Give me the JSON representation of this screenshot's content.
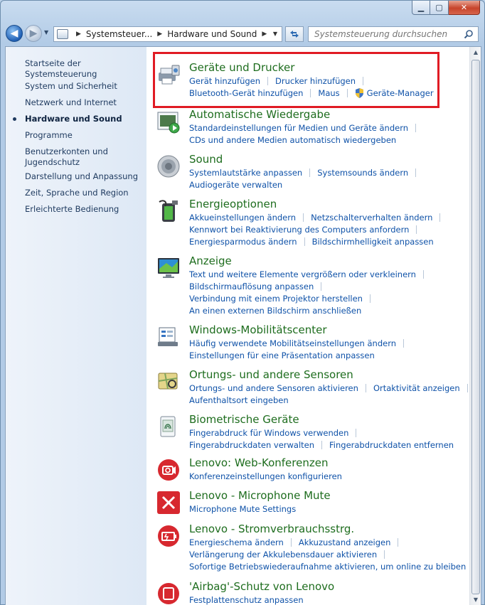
{
  "window": {
    "minimize_label": "▁",
    "maximize_label": "▢",
    "close_label": "✕"
  },
  "nav": {
    "back_label": "◀",
    "forward_label": "▶",
    "breadcrumbs": [
      "Systemsteuer...",
      "Hardware und Sound"
    ],
    "search_placeholder": "Systemsteuerung durchsuchen"
  },
  "sidebar": {
    "items": [
      {
        "label": "Startseite der Systemsteuerung"
      },
      {
        "label": "System und Sicherheit"
      },
      {
        "label": "Netzwerk und Internet"
      },
      {
        "label": "Hardware und Sound"
      },
      {
        "label": "Programme"
      },
      {
        "label": "Benutzerkonten und Jugendschutz"
      },
      {
        "label": "Darstellung und Anpassung"
      },
      {
        "label": "Zeit, Sprache und Region"
      },
      {
        "label": "Erleichterte Bedienung"
      }
    ]
  },
  "sections": [
    {
      "title": "Geräte und Drucker",
      "icon": "printer-icon",
      "lines": [
        [
          "Gerät hinzufügen",
          "Drucker hinzufügen"
        ],
        [
          "Bluetooth-Gerät hinzufügen",
          "Maus",
          "Geräte-Manager"
        ]
      ]
    },
    {
      "title": "Automatische Wiedergabe",
      "icon": "autoplay-icon",
      "lines": [
        [
          "Standardeinstellungen für Medien und Geräte ändern"
        ],
        [
          "CDs und andere Medien automatisch wiedergeben"
        ]
      ]
    },
    {
      "title": "Sound",
      "icon": "speaker-icon",
      "lines": [
        [
          "Systemlautstärke anpassen",
          "Systemsounds ändern"
        ],
        [
          "Audiogeräte verwalten"
        ]
      ]
    },
    {
      "title": "Energieoptionen",
      "icon": "battery-icon",
      "lines": [
        [
          "Akkueinstellungen ändern",
          "Netzschalterverhalten ändern"
        ],
        [
          "Kennwort bei Reaktivierung des Computers anfordern"
        ],
        [
          "Energiesparmodus ändern",
          "Bildschirmhelligkeit anpassen"
        ]
      ]
    },
    {
      "title": "Anzeige",
      "icon": "monitor-icon",
      "lines": [
        [
          "Text und weitere Elemente vergrößern oder verkleinern"
        ],
        [
          "Bildschirmauflösung anpassen"
        ],
        [
          "Verbindung mit einem Projektor herstellen"
        ],
        [
          "An einen externen Bildschirm anschließen"
        ]
      ]
    },
    {
      "title": "Windows-Mobilitätscenter",
      "icon": "mobility-center-icon",
      "lines": [
        [
          "Häufig verwendete Mobilitätseinstellungen ändern"
        ],
        [
          "Einstellungen für eine Präsentation anpassen"
        ]
      ]
    },
    {
      "title": "Ortungs- und andere Sensoren",
      "icon": "location-sensor-icon",
      "lines": [
        [
          "Ortungs- und andere Sensoren aktivieren",
          "Ortaktivität anzeigen"
        ],
        [
          "Aufenthaltsort eingeben"
        ]
      ]
    },
    {
      "title": "Biometrische Geräte",
      "icon": "fingerprint-icon",
      "lines": [
        [
          "Fingerabdruck für Windows verwenden"
        ],
        [
          "Fingerabdruckdaten verwalten",
          "Fingerabdruckdaten entfernen"
        ]
      ]
    },
    {
      "title": "Lenovo: Web-Konferenzen",
      "icon": "webcam-icon",
      "lines": [
        [
          "Konferenzeinstellungen konfigurieren"
        ]
      ]
    },
    {
      "title": "Lenovo - Microphone Mute",
      "icon": "microphone-mute-icon",
      "lines": [
        [
          "Microphone Mute Settings"
        ]
      ]
    },
    {
      "title": "Lenovo - Stromverbrauchsstrg.",
      "icon": "power-manager-icon",
      "lines": [
        [
          "Energieschema ändern",
          "Akkuzustand anzeigen"
        ],
        [
          "Verlängerung der Akkulebensdauer aktivieren"
        ],
        [
          "Sofortige Betriebswiederaufnahme aktivieren, um online zu bleiben"
        ]
      ]
    },
    {
      "title": "'Airbag'-Schutz von Lenovo",
      "icon": "airbag-icon",
      "lines": [
        [
          "Festplattenschutz anpassen"
        ]
      ]
    }
  ],
  "colors": {
    "title_green": "#1e6d1e",
    "link_blue": "#0f52a8",
    "highlight_red": "#e01b24"
  }
}
